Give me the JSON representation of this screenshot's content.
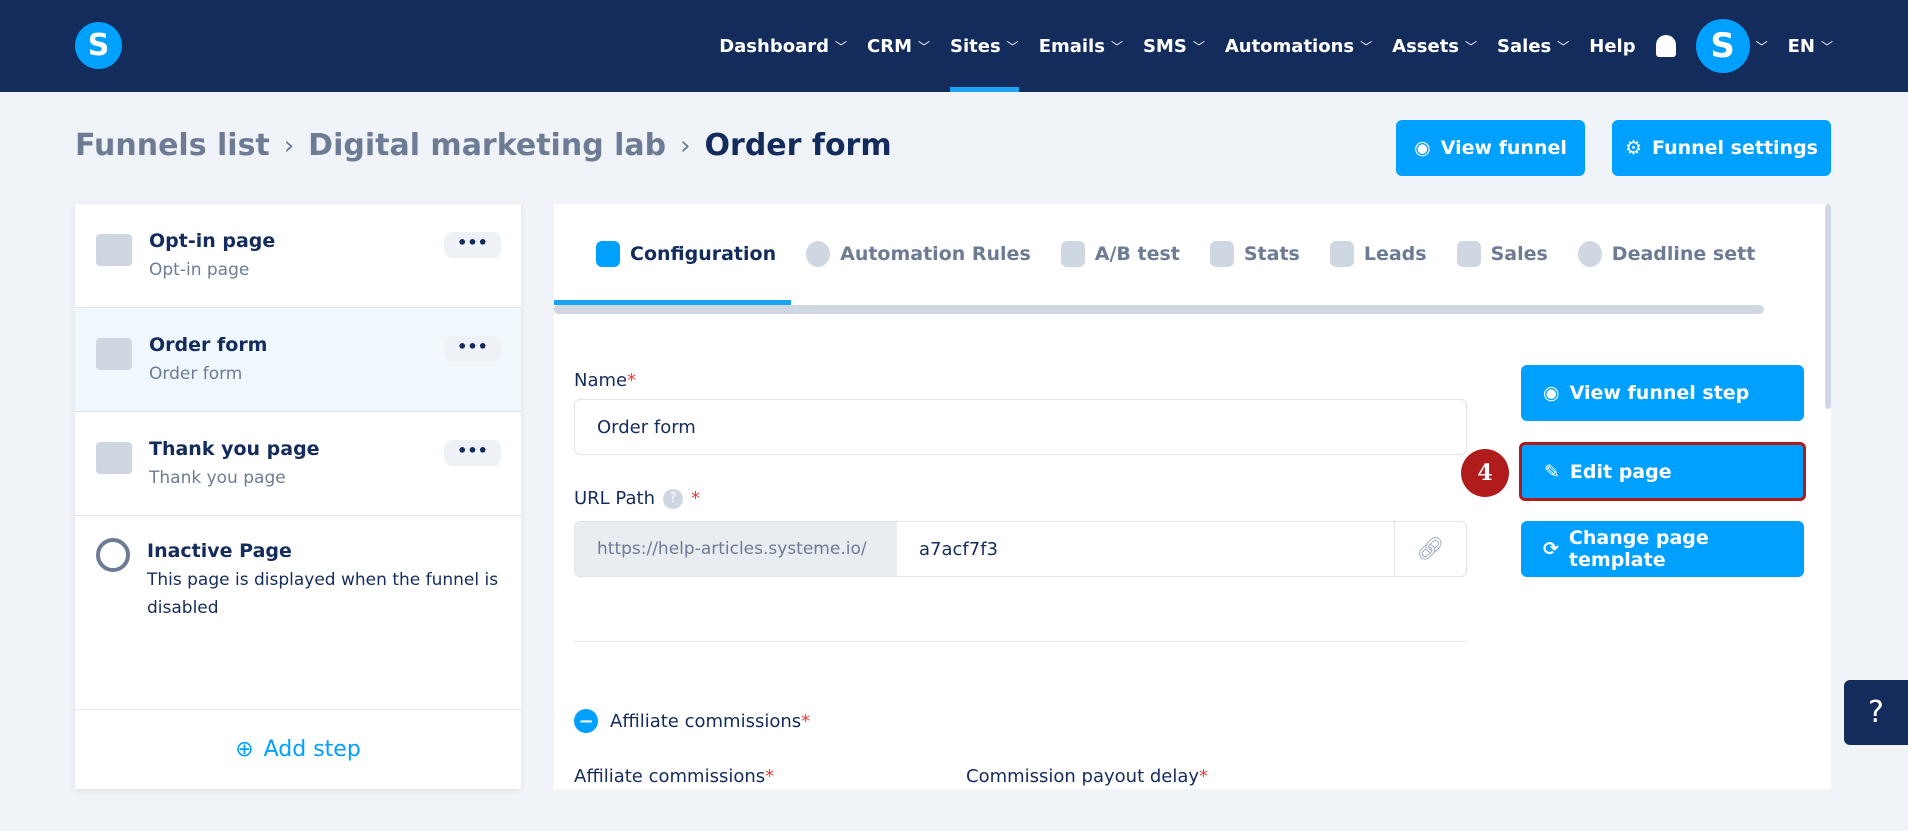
{
  "nav": {
    "logo": "S",
    "items": [
      {
        "label": "Dashboard",
        "active": false
      },
      {
        "label": "CRM",
        "active": false
      },
      {
        "label": "Sites",
        "active": true
      },
      {
        "label": "Emails",
        "active": false
      },
      {
        "label": "SMS",
        "active": false
      },
      {
        "label": "Automations",
        "active": false
      },
      {
        "label": "Assets",
        "active": false
      },
      {
        "label": "Sales",
        "active": false
      }
    ],
    "help": "Help",
    "avatar": "S",
    "lang": "EN"
  },
  "breadcrumb": [
    "Funnels list",
    "Digital marketing lab",
    "Order form"
  ],
  "header_buttons": {
    "view_funnel": "View funnel",
    "funnel_settings": "Funnel settings"
  },
  "steps": [
    {
      "title": "Opt-in page",
      "subtitle": "Opt-in page",
      "icon": "page-icon"
    },
    {
      "title": "Order form",
      "subtitle": "Order form",
      "icon": "cart-icon",
      "selected": true
    },
    {
      "title": "Thank you page",
      "subtitle": "Thank you page",
      "icon": "cart-check-icon"
    }
  ],
  "inactive": {
    "title": "Inactive Page",
    "description": "This page is displayed when the funnel is disabled"
  },
  "add_step": "Add step",
  "tabs": [
    "Configuration",
    "Automation Rules",
    "A/B test",
    "Stats",
    "Leads",
    "Sales",
    "Deadline sett"
  ],
  "form": {
    "name_label": "Name",
    "name_value": "Order form",
    "url_label": "URL Path",
    "url_prefix": "https://help-articles.systeme.io/",
    "url_value": "a7acf7f3",
    "affiliate_toggle": "Affiliate commissions",
    "affiliate_label": "Affiliate commissions",
    "payout_label": "Commission payout delay",
    "required": "*"
  },
  "actions": {
    "view_step": "View funnel step",
    "edit_page": "Edit page",
    "change_template": "Change page template"
  },
  "annotation": "4",
  "help_button": "?",
  "colors": {
    "navbar": "#142c5c",
    "accent": "#00a0ff",
    "highlight": "#b01c1c"
  }
}
